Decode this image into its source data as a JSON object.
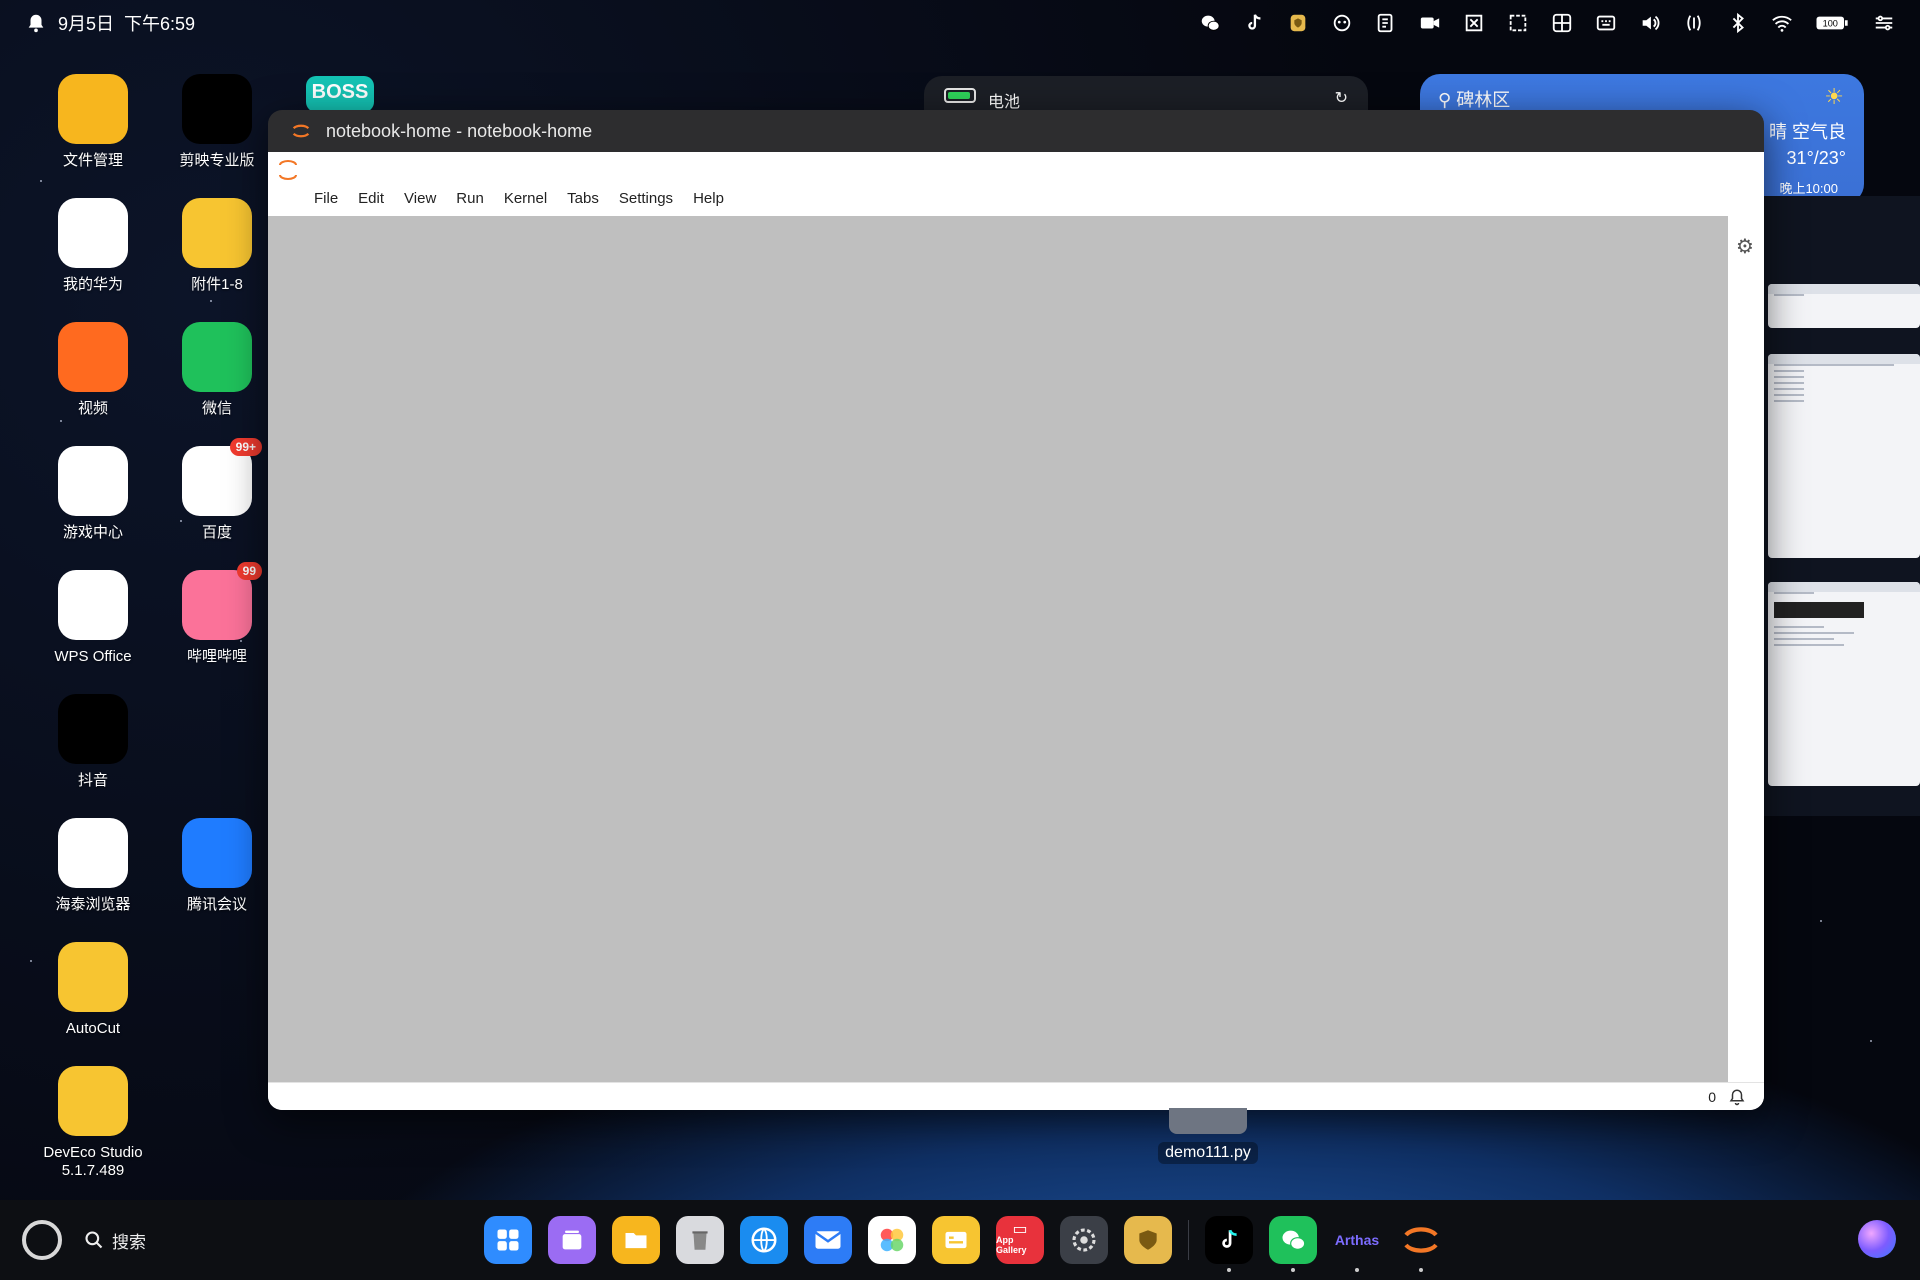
{
  "statusbar": {
    "date": "9月5日",
    "time": "下午6:59",
    "battery": "100"
  },
  "desktop_icons": [
    {
      "label": "文件管理",
      "icon": "file-manager-icon",
      "color": "#f7b61e"
    },
    {
      "label": "剪映专业版",
      "icon": "capcut-icon",
      "color": "#000000"
    },
    {
      "label": "我的华为",
      "icon": "my-huawei-icon",
      "color": "#ffffff"
    },
    {
      "label": "附件1-8",
      "icon": "folder-icon",
      "color": "#f7c531"
    },
    {
      "label": "视频",
      "icon": "video-icon",
      "color": "#ff6a1f"
    },
    {
      "label": "微信",
      "icon": "wechat-icon",
      "color": "#1fc15b"
    },
    {
      "label": "游戏中心",
      "icon": "game-center-icon",
      "color": "#ffffff"
    },
    {
      "label": "百度",
      "icon": "baidu-icon",
      "color": "#ffffff",
      "badge": "99+"
    },
    {
      "label": "WPS Office",
      "icon": "wps-icon",
      "color": "#ffffff"
    },
    {
      "label": "哔哩哔哩",
      "icon": "bilibili-icon",
      "color": "#fb7299",
      "badge": "99"
    },
    {
      "label": "抖音",
      "icon": "douyin-icon",
      "color": "#000000"
    },
    {
      "label": "海泰浏览器",
      "icon": "browser-icon",
      "color": "#ffffff"
    },
    {
      "label": "腾讯会议",
      "icon": "tencent-meeting-icon",
      "color": "#1f7cff"
    },
    {
      "label": "AutoCut",
      "icon": "folder-icon",
      "color": "#f7c531"
    },
    {
      "label": "DevEco Studio 5.1.7.489",
      "icon": "folder-icon",
      "color": "#f7c531"
    }
  ],
  "widgets": {
    "boss": "BOSS",
    "battery_label": "电池",
    "weather_location": "碑林区",
    "weather_condition": "晴  空气良",
    "weather_temp": "31°/23°",
    "weather_time": "晚上10:00"
  },
  "window": {
    "title": "notebook-home - notebook-home",
    "menu": [
      "File",
      "Edit",
      "View",
      "Run",
      "Kernel",
      "Tabs",
      "Settings",
      "Help"
    ],
    "status_count": "0"
  },
  "desktop_file": {
    "name": "demo111.py"
  },
  "taskbar": {
    "search_label": "搜索",
    "arthas_label": "Arthas",
    "app_gallery_label": "App Gallery"
  },
  "colors": {
    "workspace": "#bfbfbf",
    "jupyter_orange": "#f37726"
  }
}
